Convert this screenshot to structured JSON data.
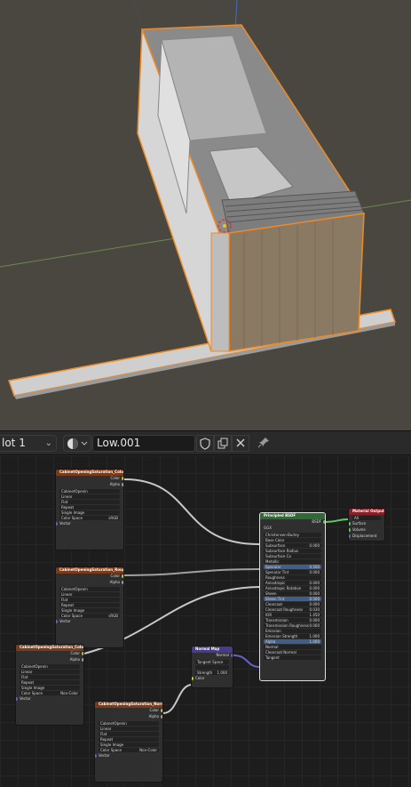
{
  "header": {
    "slot_label": "lot 1",
    "slot_chevron": "⌄",
    "material_icon": "material-sphere-icon",
    "material_name": "Low.001",
    "buttons": [
      "shield-icon",
      "duplicate-icon",
      "close-icon",
      "pin-icon"
    ]
  },
  "nodes": {
    "tex1": {
      "title": "CabinetOpeningSaturation_Colo",
      "out_color": "Color",
      "out_alpha": "Alpha",
      "image": "CabinetOpenin",
      "interp": "Linear",
      "proj": "Flat",
      "ext": "Repeat",
      "src": "Single Image",
      "cs_label": "Color Space",
      "cs_value": "sRGB",
      "vector": "Vector"
    },
    "tex2": {
      "title": "CabinetOpeningSaturation_Roug",
      "out_color": "Color",
      "out_alpha": "Alpha",
      "image": "CabinetOpenin",
      "interp": "Linear",
      "proj": "Flat",
      "ext": "Repeat",
      "src": "Single Image",
      "cs_label": "Color Space",
      "cs_value": "sRGB",
      "vector": "Vector"
    },
    "tex3": {
      "title": "CabinetOpeningSaturation_Colo",
      "out_color": "Color",
      "out_alpha": "Alpha",
      "image": "CabinetOpenin",
      "interp": "Linear",
      "proj": "Flat",
      "ext": "Repeat",
      "src": "Single Image",
      "cs_label": "Color Space",
      "cs_value": "Non-Color",
      "vector": "Vector"
    },
    "tex4": {
      "title": "CabinetOpeningSaturation_Norm",
      "out_color": "Color",
      "out_alpha": "Alpha",
      "image": "CabinetOpenin",
      "interp": "Linear",
      "proj": "Flat",
      "ext": "Repeat",
      "src": "Single Image",
      "cs_label": "Color Space",
      "cs_value": "Non-Color",
      "vector": "Vector"
    },
    "normal": {
      "title": "Normal Map",
      "out_normal": "Normal",
      "space": "Tangent Space",
      "uv": "",
      "strength_label": "Strength",
      "strength_value": "1.000",
      "color": "Color"
    },
    "bsdf": {
      "title": "Principled BSDF",
      "out_bsdf": "BSDF",
      "ggx": "GGX",
      "sss_method": "Christensen-Burley",
      "rows": [
        {
          "label": "Base Color",
          "value": ""
        },
        {
          "label": "Subsurface",
          "value": "0.000"
        },
        {
          "label": "Subsurface Radius",
          "value": ""
        },
        {
          "label": "Subsurface Co",
          "value": ""
        },
        {
          "label": "Metallic",
          "value": ""
        },
        {
          "label": "Specular",
          "value": "0.500"
        },
        {
          "label": "Specular Tint",
          "value": "0.000"
        },
        {
          "label": "Roughness",
          "value": ""
        },
        {
          "label": "Anisotropic",
          "value": "0.000"
        },
        {
          "label": "Anisotropic Rotation",
          "value": "0.000"
        },
        {
          "label": "Sheen",
          "value": "0.000"
        },
        {
          "label": "Sheen Tint",
          "value": "0.500"
        },
        {
          "label": "Clearcoat",
          "value": "0.000"
        },
        {
          "label": "Clearcoat Roughness",
          "value": "0.030"
        },
        {
          "label": "IOR",
          "value": "1.450"
        },
        {
          "label": "Transmission",
          "value": "0.000"
        },
        {
          "label": "Transmission Roughness",
          "value": "0.000"
        },
        {
          "label": "Emission",
          "value": ""
        },
        {
          "label": "Emission Strength",
          "value": "1.000"
        },
        {
          "label": "Alpha",
          "value": "1.000"
        },
        {
          "label": "Normal",
          "value": ""
        },
        {
          "label": "Clearcoat Normal",
          "value": ""
        },
        {
          "label": "Tangent",
          "value": ""
        }
      ]
    },
    "output": {
      "title": "Material Output",
      "target": "All",
      "surface": "Surface",
      "volume": "Volume",
      "displacement": "Displacement"
    }
  },
  "colors": {
    "selection_orange": "#f08a24",
    "viewport_bg": "#4a4740",
    "node_editor_bg": "#1d1d1d",
    "texture_header": "#7a3b1a",
    "shader_header": "#2f6a36",
    "vector_header": "#4a3a8c",
    "output_header": "#8c1f26"
  }
}
